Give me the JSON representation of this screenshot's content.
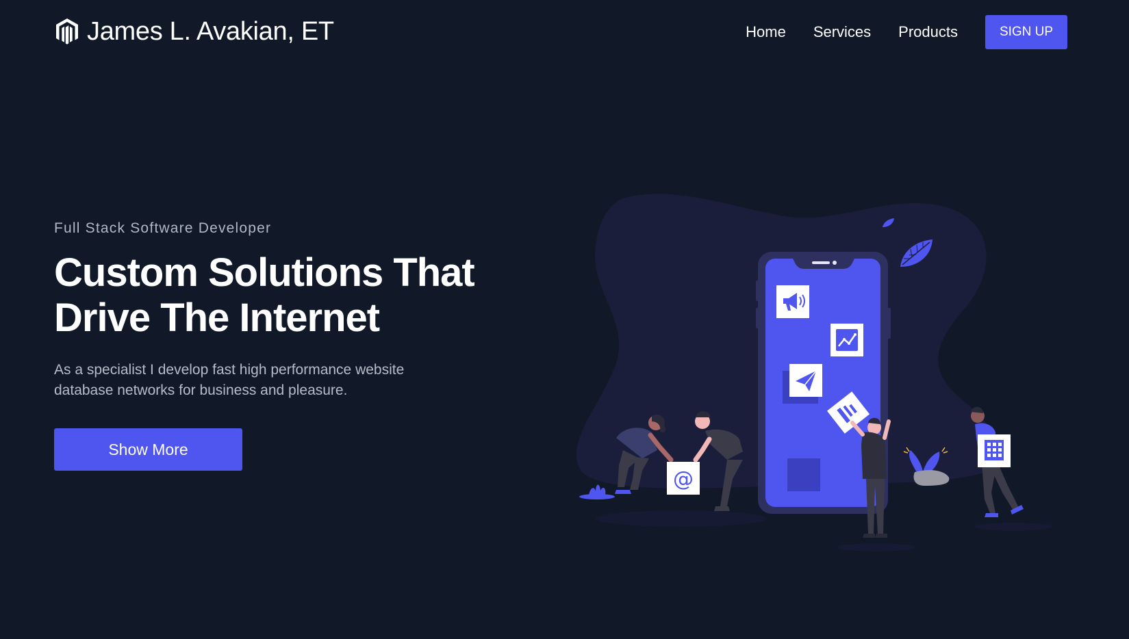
{
  "header": {
    "brand_name": "James L. Avakian, ET",
    "brand_logo_icon": "magento-logo-icon",
    "nav": {
      "home": "Home",
      "services": "Services",
      "products": "Products"
    },
    "signup_label": "SIGN UP"
  },
  "hero": {
    "eyebrow": "Full Stack Software Developer",
    "title_line1": "Custom Solutions That",
    "title_line2": "Drive The Internet",
    "description": "As a specialist I develop fast high performance website database networks for business and pleasure.",
    "cta_label": "Show More"
  },
  "illustration": {
    "icons": [
      "megaphone-icon",
      "chart-icon",
      "paper-plane-icon",
      "at-sign-icon",
      "building-icon",
      "leaf-icon"
    ],
    "at_sign": "@"
  },
  "colors": {
    "background": "#111827",
    "accent": "#4f56f0",
    "blob": "#1b1e3b",
    "text_muted": "#b3b8c4"
  }
}
